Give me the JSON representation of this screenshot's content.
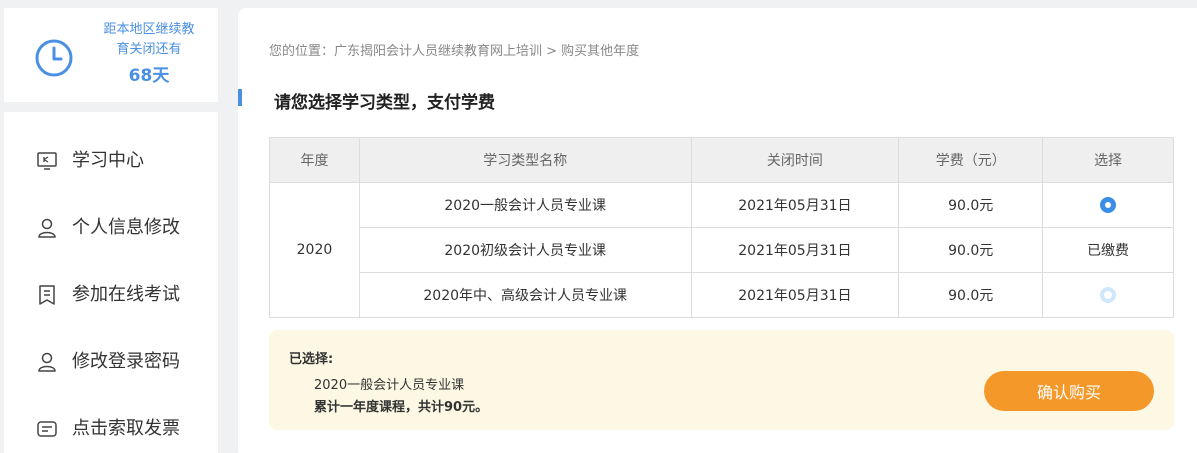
{
  "countdown": {
    "text_line1": "距本地区继续教",
    "text_line2": "育关闭还有",
    "days": "68天"
  },
  "menu": {
    "items": [
      {
        "label": "学习中心",
        "icon": "monitor-icon"
      },
      {
        "label": "个人信息修改",
        "icon": "user-icon"
      },
      {
        "label": "参加在线考试",
        "icon": "exam-icon"
      },
      {
        "label": "修改登录密码",
        "icon": "user-icon"
      },
      {
        "label": "点击索取发票",
        "icon": "invoice-icon"
      }
    ]
  },
  "breadcrumb": "您的位置：广东揭阳会计人员继续教育网上培训 > 购买其他年度",
  "section_title": "请您选择学习类型，支付学费",
  "table": {
    "headers": [
      "年度",
      "学习类型名称",
      "关闭时间",
      "学费（元）",
      "选择"
    ],
    "year": "2020",
    "rows": [
      {
        "name": "2020一般会计人员专业课",
        "close": "2021年05月31日",
        "fee": "90.0元",
        "select": "radio-selected"
      },
      {
        "name": "2020初级会计人员专业课",
        "close": "2021年05月31日",
        "fee": "90.0元",
        "select": "已缴费"
      },
      {
        "name": "2020年中、高级会计人员专业课",
        "close": "2021年05月31日",
        "fee": "90.0元",
        "select": "radio-unselected"
      }
    ]
  },
  "selection": {
    "head": "已选择:",
    "course": "2020一般会计人员专业课",
    "total": "累计一年度课程，共计90元。"
  },
  "confirm_label": "确认购买",
  "colors": {
    "accent": "#4a90e2",
    "button": "#f5982a",
    "summary_bg": "#fdf8e4"
  }
}
